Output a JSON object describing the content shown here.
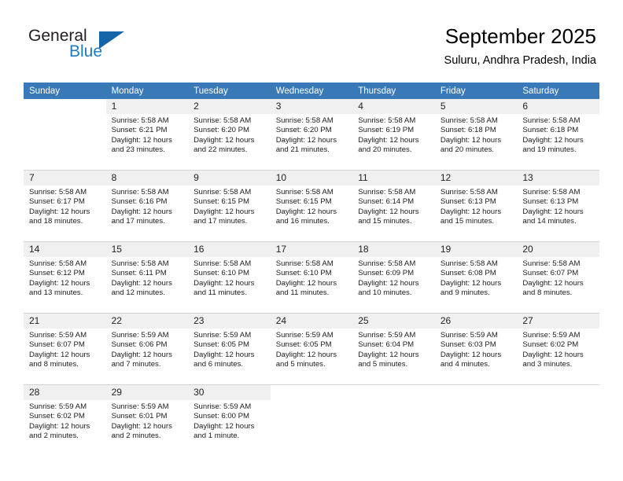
{
  "brand": {
    "name_top": "General",
    "name_bottom": "Blue",
    "triangle_color": "#1565a8",
    "blue_color": "#1f7ac0"
  },
  "header": {
    "title": "September 2025",
    "subtitle": "Suluru, Andhra Pradesh, India"
  },
  "theme": {
    "header_bg": "#3a79b8",
    "daynum_bg": "#f0f0f0",
    "grid_line": "#d4d4d4"
  },
  "weekdays": [
    "Sunday",
    "Monday",
    "Tuesday",
    "Wednesday",
    "Thursday",
    "Friday",
    "Saturday"
  ],
  "weeks": [
    [
      {
        "day": "",
        "lines": []
      },
      {
        "day": "1",
        "lines": [
          "Sunrise: 5:58 AM",
          "Sunset: 6:21 PM",
          "Daylight: 12 hours",
          "and 23 minutes."
        ]
      },
      {
        "day": "2",
        "lines": [
          "Sunrise: 5:58 AM",
          "Sunset: 6:20 PM",
          "Daylight: 12 hours",
          "and 22 minutes."
        ]
      },
      {
        "day": "3",
        "lines": [
          "Sunrise: 5:58 AM",
          "Sunset: 6:20 PM",
          "Daylight: 12 hours",
          "and 21 minutes."
        ]
      },
      {
        "day": "4",
        "lines": [
          "Sunrise: 5:58 AM",
          "Sunset: 6:19 PM",
          "Daylight: 12 hours",
          "and 20 minutes."
        ]
      },
      {
        "day": "5",
        "lines": [
          "Sunrise: 5:58 AM",
          "Sunset: 6:18 PM",
          "Daylight: 12 hours",
          "and 20 minutes."
        ]
      },
      {
        "day": "6",
        "lines": [
          "Sunrise: 5:58 AM",
          "Sunset: 6:18 PM",
          "Daylight: 12 hours",
          "and 19 minutes."
        ]
      }
    ],
    [
      {
        "day": "7",
        "lines": [
          "Sunrise: 5:58 AM",
          "Sunset: 6:17 PM",
          "Daylight: 12 hours",
          "and 18 minutes."
        ]
      },
      {
        "day": "8",
        "lines": [
          "Sunrise: 5:58 AM",
          "Sunset: 6:16 PM",
          "Daylight: 12 hours",
          "and 17 minutes."
        ]
      },
      {
        "day": "9",
        "lines": [
          "Sunrise: 5:58 AM",
          "Sunset: 6:15 PM",
          "Daylight: 12 hours",
          "and 17 minutes."
        ]
      },
      {
        "day": "10",
        "lines": [
          "Sunrise: 5:58 AM",
          "Sunset: 6:15 PM",
          "Daylight: 12 hours",
          "and 16 minutes."
        ]
      },
      {
        "day": "11",
        "lines": [
          "Sunrise: 5:58 AM",
          "Sunset: 6:14 PM",
          "Daylight: 12 hours",
          "and 15 minutes."
        ]
      },
      {
        "day": "12",
        "lines": [
          "Sunrise: 5:58 AM",
          "Sunset: 6:13 PM",
          "Daylight: 12 hours",
          "and 15 minutes."
        ]
      },
      {
        "day": "13",
        "lines": [
          "Sunrise: 5:58 AM",
          "Sunset: 6:13 PM",
          "Daylight: 12 hours",
          "and 14 minutes."
        ]
      }
    ],
    [
      {
        "day": "14",
        "lines": [
          "Sunrise: 5:58 AM",
          "Sunset: 6:12 PM",
          "Daylight: 12 hours",
          "and 13 minutes."
        ]
      },
      {
        "day": "15",
        "lines": [
          "Sunrise: 5:58 AM",
          "Sunset: 6:11 PM",
          "Daylight: 12 hours",
          "and 12 minutes."
        ]
      },
      {
        "day": "16",
        "lines": [
          "Sunrise: 5:58 AM",
          "Sunset: 6:10 PM",
          "Daylight: 12 hours",
          "and 11 minutes."
        ]
      },
      {
        "day": "17",
        "lines": [
          "Sunrise: 5:58 AM",
          "Sunset: 6:10 PM",
          "Daylight: 12 hours",
          "and 11 minutes."
        ]
      },
      {
        "day": "18",
        "lines": [
          "Sunrise: 5:58 AM",
          "Sunset: 6:09 PM",
          "Daylight: 12 hours",
          "and 10 minutes."
        ]
      },
      {
        "day": "19",
        "lines": [
          "Sunrise: 5:58 AM",
          "Sunset: 6:08 PM",
          "Daylight: 12 hours",
          "and 9 minutes."
        ]
      },
      {
        "day": "20",
        "lines": [
          "Sunrise: 5:58 AM",
          "Sunset: 6:07 PM",
          "Daylight: 12 hours",
          "and 8 minutes."
        ]
      }
    ],
    [
      {
        "day": "21",
        "lines": [
          "Sunrise: 5:59 AM",
          "Sunset: 6:07 PM",
          "Daylight: 12 hours",
          "and 8 minutes."
        ]
      },
      {
        "day": "22",
        "lines": [
          "Sunrise: 5:59 AM",
          "Sunset: 6:06 PM",
          "Daylight: 12 hours",
          "and 7 minutes."
        ]
      },
      {
        "day": "23",
        "lines": [
          "Sunrise: 5:59 AM",
          "Sunset: 6:05 PM",
          "Daylight: 12 hours",
          "and 6 minutes."
        ]
      },
      {
        "day": "24",
        "lines": [
          "Sunrise: 5:59 AM",
          "Sunset: 6:05 PM",
          "Daylight: 12 hours",
          "and 5 minutes."
        ]
      },
      {
        "day": "25",
        "lines": [
          "Sunrise: 5:59 AM",
          "Sunset: 6:04 PM",
          "Daylight: 12 hours",
          "and 5 minutes."
        ]
      },
      {
        "day": "26",
        "lines": [
          "Sunrise: 5:59 AM",
          "Sunset: 6:03 PM",
          "Daylight: 12 hours",
          "and 4 minutes."
        ]
      },
      {
        "day": "27",
        "lines": [
          "Sunrise: 5:59 AM",
          "Sunset: 6:02 PM",
          "Daylight: 12 hours",
          "and 3 minutes."
        ]
      }
    ],
    [
      {
        "day": "28",
        "lines": [
          "Sunrise: 5:59 AM",
          "Sunset: 6:02 PM",
          "Daylight: 12 hours",
          "and 2 minutes."
        ]
      },
      {
        "day": "29",
        "lines": [
          "Sunrise: 5:59 AM",
          "Sunset: 6:01 PM",
          "Daylight: 12 hours",
          "and 2 minutes."
        ]
      },
      {
        "day": "30",
        "lines": [
          "Sunrise: 5:59 AM",
          "Sunset: 6:00 PM",
          "Daylight: 12 hours",
          "and 1 minute."
        ]
      },
      {
        "day": "",
        "lines": []
      },
      {
        "day": "",
        "lines": []
      },
      {
        "day": "",
        "lines": []
      },
      {
        "day": "",
        "lines": []
      }
    ]
  ]
}
